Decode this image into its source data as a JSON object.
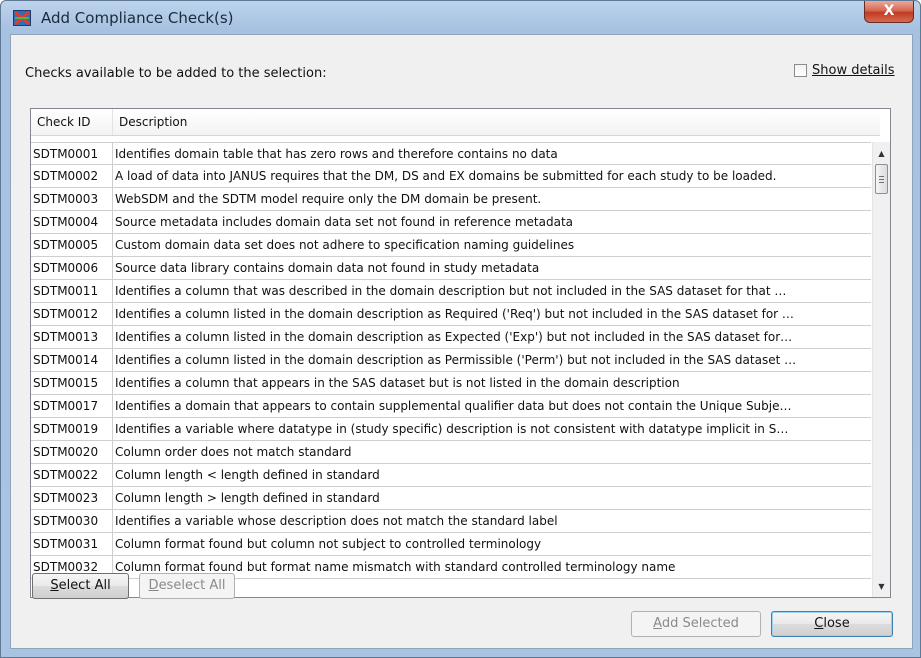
{
  "window": {
    "title": "Add Compliance Check(s)",
    "close_glyph": "X"
  },
  "prompt": {
    "label": "Checks available to be added to the selection:"
  },
  "show_details": {
    "label": "Show details",
    "checked": false
  },
  "table": {
    "columns": [
      "Check ID",
      "Description"
    ],
    "rows": [
      {
        "id": "SDTM0001",
        "desc": "Identifies domain table that has zero rows and therefore contains no data"
      },
      {
        "id": "SDTM0002",
        "desc": "A load of data into JANUS requires that the DM, DS and EX domains be submitted for each study to be loaded."
      },
      {
        "id": "SDTM0003",
        "desc": "WebSDM and the SDTM model require only the DM domain be present."
      },
      {
        "id": "SDTM0004",
        "desc": "Source metadata includes domain data set not found in reference metadata"
      },
      {
        "id": "SDTM0005",
        "desc": "Custom domain data set does not adhere to specification naming guidelines"
      },
      {
        "id": "SDTM0006",
        "desc": "Source data library contains domain data not found in study metadata"
      },
      {
        "id": "SDTM0011",
        "desc": "Identifies a column that was described in the domain description but not included in the SAS dataset for that …"
      },
      {
        "id": "SDTM0012",
        "desc": "Identifies a column listed in the domain description as Required ('Req') but not included in the SAS dataset for …"
      },
      {
        "id": "SDTM0013",
        "desc": "Identifies a column listed in the domain description as Expected ('Exp') but not included in the SAS dataset for…"
      },
      {
        "id": "SDTM0014",
        "desc": "Identifies a column listed in the domain description as Permissible ('Perm') but not included in the SAS dataset …"
      },
      {
        "id": "SDTM0015",
        "desc": "Identifies a column that appears in the SAS dataset but is not listed in the domain description"
      },
      {
        "id": "SDTM0017",
        "desc": "Identifies a domain that appears to contain supplemental qualifier data but does not contain the Unique Subje…"
      },
      {
        "id": "SDTM0019",
        "desc": "Identifies a variable where datatype in (study specific) description is not consistent with datatype implicit in S…"
      },
      {
        "id": "SDTM0020",
        "desc": "Column order does not match standard"
      },
      {
        "id": "SDTM0022",
        "desc": "Column length < length defined in standard"
      },
      {
        "id": "SDTM0023",
        "desc": "Column length > length defined in standard"
      },
      {
        "id": "SDTM0030",
        "desc": "Identifies a variable whose description does not match the standard label"
      },
      {
        "id": "SDTM0031",
        "desc": "Column format found but column not subject to controlled terminology"
      },
      {
        "id": "SDTM0032",
        "desc": "Column format found but format name mismatch with standard controlled terminology name"
      }
    ]
  },
  "buttons": {
    "select_all": {
      "accel": "S",
      "rest": "elect All"
    },
    "deselect_all": {
      "accel": "D",
      "rest": "eselect All"
    },
    "add_selected": {
      "accel": "A",
      "rest": "dd Selected"
    },
    "close": {
      "accel": "C",
      "rest": "lose"
    }
  },
  "colors": {
    "title_bar": "#a9c4e3",
    "close_button": "#c13b23",
    "dialog_bg": "#f0f0f0"
  }
}
